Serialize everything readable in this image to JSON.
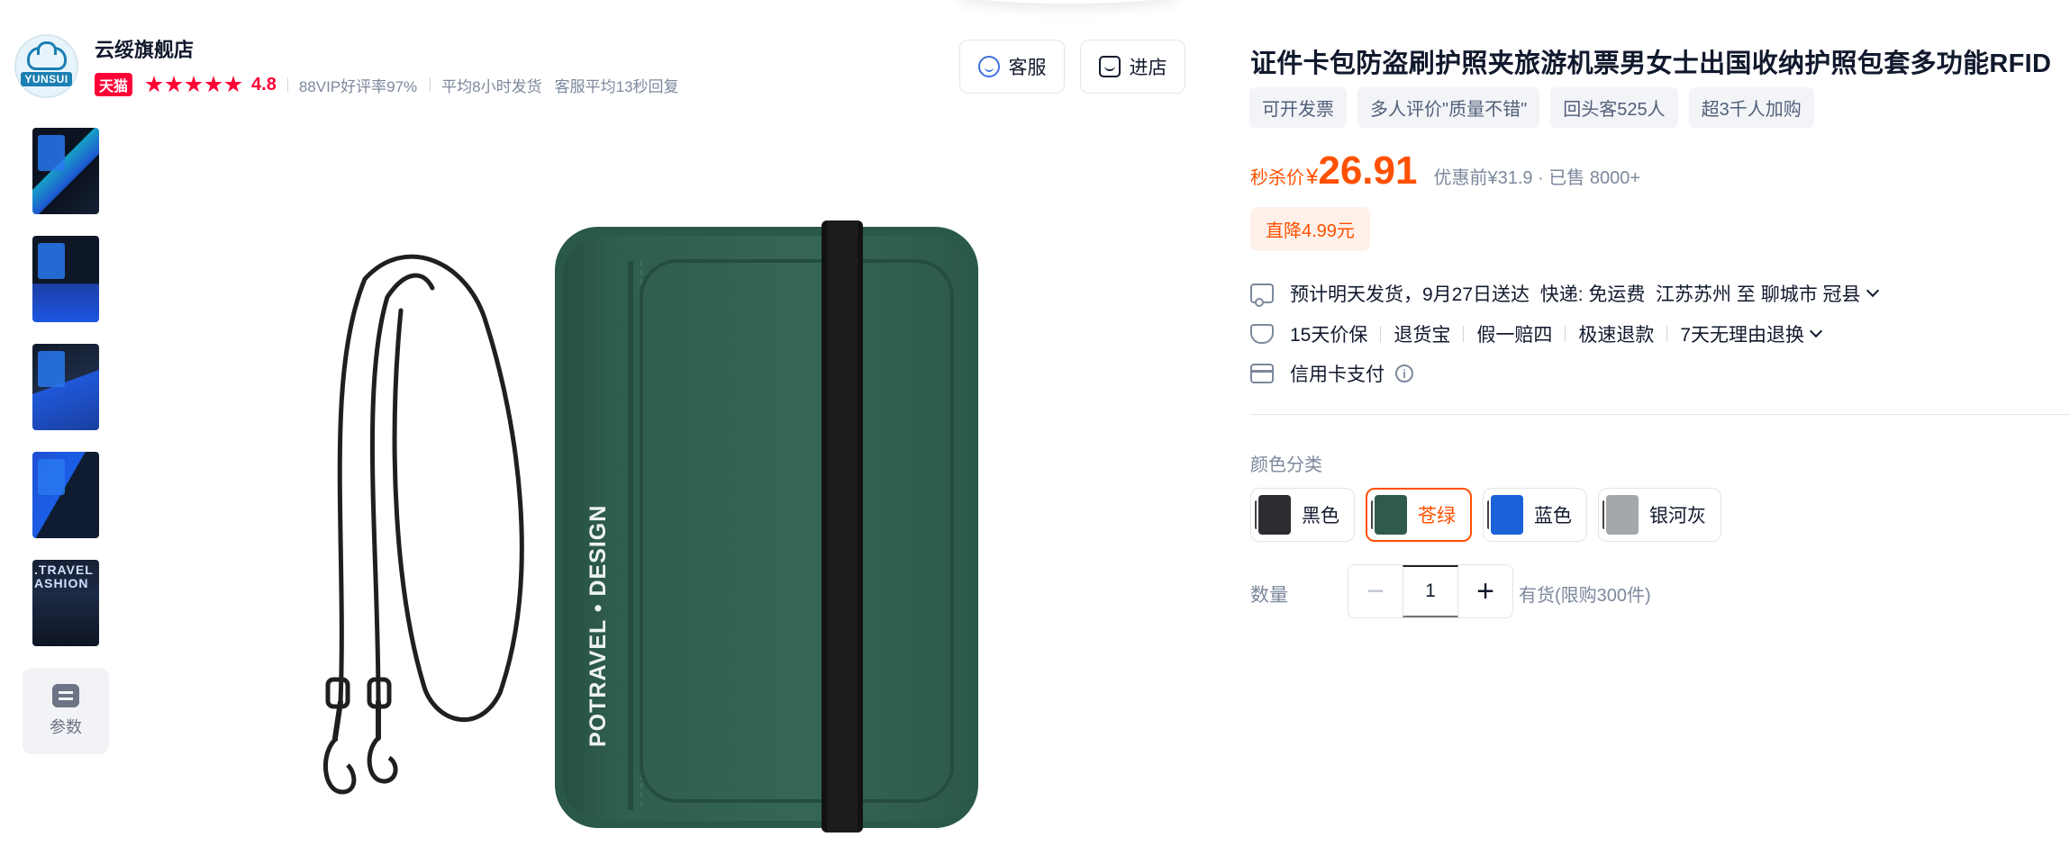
{
  "shop": {
    "logo_text": "YUNSUI",
    "name": "云绥旗舰店",
    "badge": "天猫",
    "rating": "4.8",
    "stats": [
      "88VIP好评率97%",
      "平均8小时发货",
      "客服平均13秒回复"
    ],
    "service_label": "客服",
    "store_label": "进店"
  },
  "gallery": {
    "thumb_5_text": ".TRAVEL\nASHION",
    "params_label": "参数"
  },
  "main_image": {
    "strap_brand_text": "POTRAVEL • DESIGN"
  },
  "product": {
    "title": "证件卡包防盗刷护照夹旅游机票男女士出国收纳护照包套多功能RFID",
    "tags": [
      "可开发票",
      "多人评价\"质量不错\"",
      "回头客525人",
      "超3千人加购"
    ],
    "price_label": "秒杀价",
    "currency": "¥",
    "price": "26.91",
    "price_info": "优惠前¥31.9 · 已售 8000+",
    "discount": "直降4.99元"
  },
  "delivery": {
    "text": "预计明天发货，9月27日送达  快递: 免运费  江苏苏州 至 聊城市 冠县"
  },
  "guarantees": [
    "15天价保",
    "退货宝",
    "假一赔四",
    "极速退款",
    "7天无理由退换"
  ],
  "payment": {
    "text": "信用卡支付"
  },
  "colors": {
    "label": "颜色分类",
    "options": [
      {
        "name": "黑色",
        "swatch": "#2b2d31"
      },
      {
        "name": "苍绿",
        "swatch": "#2f5b4f"
      },
      {
        "name": "蓝色",
        "swatch": "#1b61d8"
      },
      {
        "name": "银河灰",
        "swatch": "#a4a7ab"
      }
    ],
    "selected": "苍绿"
  },
  "quantity": {
    "label": "数量",
    "value": "1",
    "stock": "有货(限购300件)"
  },
  "theme": {
    "accent": "#ff5000",
    "tmall_red": "#ff0036",
    "wallet_green": "#2e5e50",
    "text_muted": "#7c889c"
  }
}
